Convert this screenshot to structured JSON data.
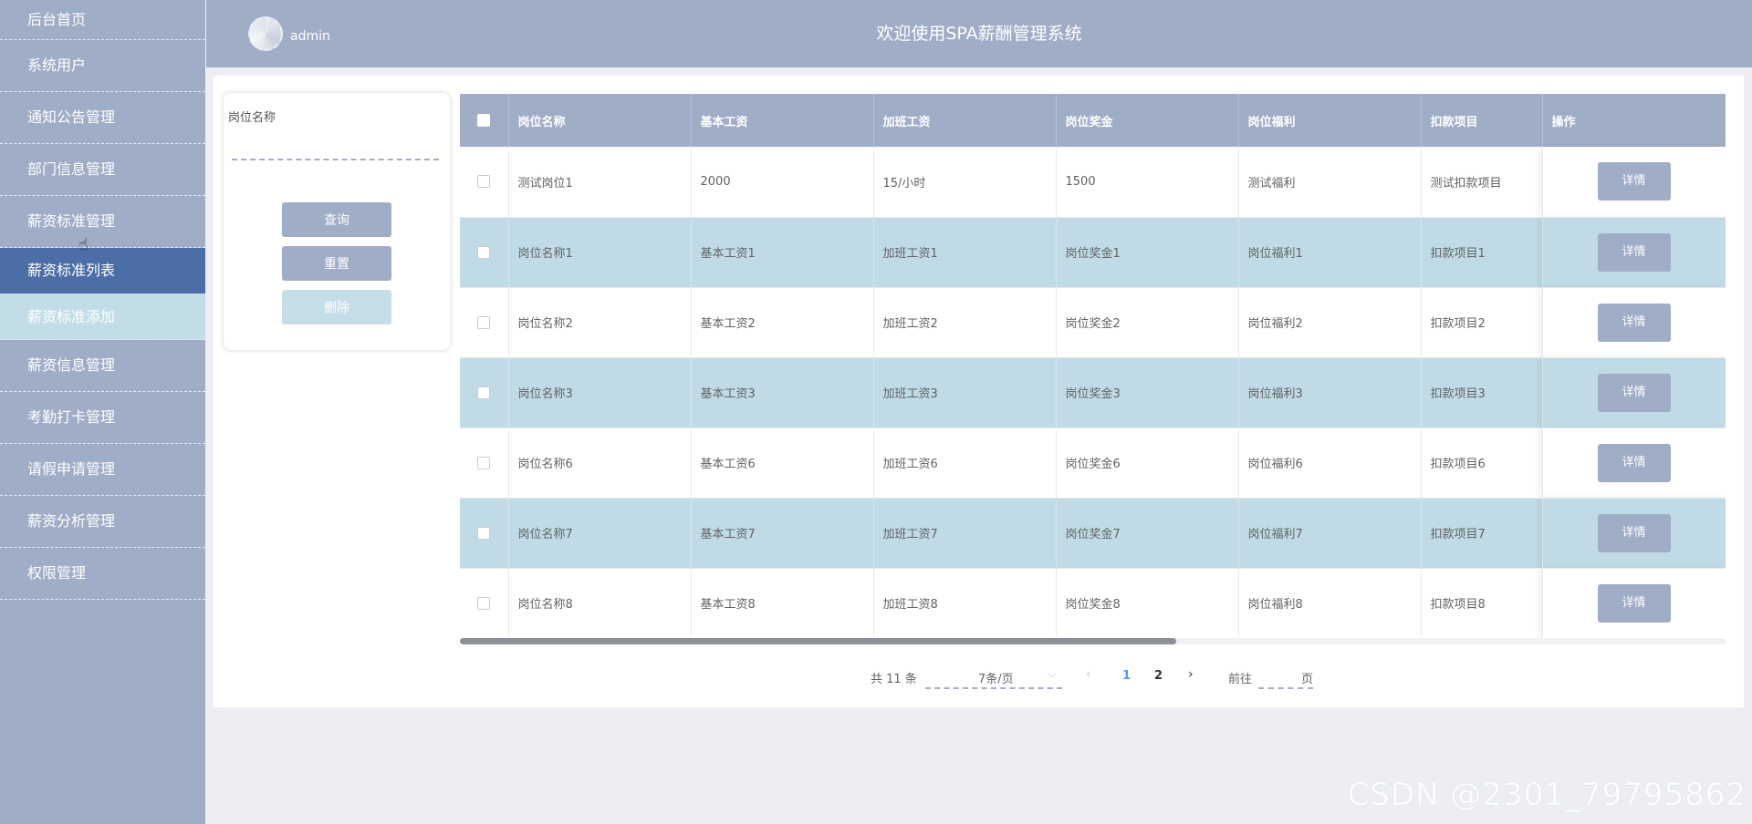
{
  "sidebar": {
    "items": [
      {
        "label": "后台首页"
      },
      {
        "label": "系统用户"
      },
      {
        "label": "通知公告管理"
      },
      {
        "label": "部门信息管理"
      },
      {
        "label": "薪资标准管理"
      },
      {
        "label": "薪资标准列表"
      },
      {
        "label": "薪资标准添加"
      },
      {
        "label": "薪资信息管理"
      },
      {
        "label": "考勤打卡管理"
      },
      {
        "label": "请假申请管理"
      },
      {
        "label": "薪资分析管理"
      },
      {
        "label": "权限管理"
      }
    ]
  },
  "header": {
    "username": "admin",
    "title": "欢迎使用SPA薪酬管理系统"
  },
  "search": {
    "label": "岗位名称",
    "query_btn": "查询",
    "reset_btn": "重置",
    "delete_btn": "删除"
  },
  "table": {
    "columns": [
      "岗位名称",
      "基本工资",
      "加班工资",
      "岗位奖金",
      "岗位福利",
      "扣款项目",
      "操作"
    ],
    "detail_label": "详情",
    "rows": [
      [
        "测试岗位1",
        "2000",
        "15/小时",
        "1500",
        "测试福利",
        "测试扣款项目"
      ],
      [
        "岗位名称1",
        "基本工资1",
        "加班工资1",
        "岗位奖金1",
        "岗位福利1",
        "扣款项目1"
      ],
      [
        "岗位名称2",
        "基本工资2",
        "加班工资2",
        "岗位奖金2",
        "岗位福利2",
        "扣款项目2"
      ],
      [
        "岗位名称3",
        "基本工资3",
        "加班工资3",
        "岗位奖金3",
        "岗位福利3",
        "扣款项目3"
      ],
      [
        "岗位名称6",
        "基本工资6",
        "加班工资6",
        "岗位奖金6",
        "岗位福利6",
        "扣款项目6"
      ],
      [
        "岗位名称7",
        "基本工资7",
        "加班工资7",
        "岗位奖金7",
        "岗位福利7",
        "扣款项目7"
      ],
      [
        "岗位名称8",
        "基本工资8",
        "加班工资8",
        "岗位奖金8",
        "岗位福利8",
        "扣款项目8"
      ]
    ]
  },
  "pagination": {
    "total": "共 11 条",
    "page_size": "7条/页",
    "pages": [
      "1",
      "2"
    ],
    "goto_label": "前往",
    "page_suffix": "页"
  },
  "watermark": "CSDN @2301_79795862",
  "colors": {
    "primary": "#9fadc7",
    "active_menu": "#4c6ea6",
    "stripe": "#c0dbe5",
    "link": "#409eff"
  }
}
